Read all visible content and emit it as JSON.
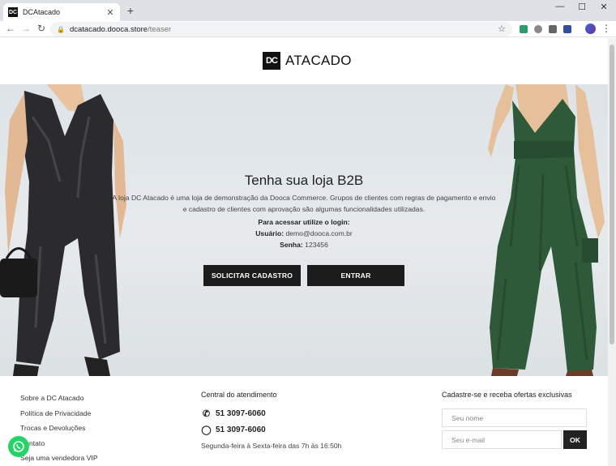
{
  "browser": {
    "tab_title": "DCAtacado",
    "tab_favicon": "DC",
    "new_tab": "+",
    "url_host": "dcatacado.dooca.store",
    "url_path": "/teaser",
    "minimize": "—",
    "maximize": "☐",
    "close": "✕"
  },
  "brand": {
    "mark": "DC",
    "name": "ATACADO"
  },
  "hero": {
    "title": "Tenha sua loja B2B",
    "description": "A loja DC Atacado é uma loja de demonstração da Dooca Commerce. Grupos de clientes com regras de pagamento e envio e cadastro de clientes com aprovação são algumas funcionalidades utilizadas.",
    "login_heading": "Para acessar utilize o login:",
    "user_label": "Usuário:",
    "user_value": "demo@dooca.com.br",
    "password_label": "Senha:",
    "password_value": "123456",
    "signup_button": "SOLICITAR CADASTRO",
    "enter_button": "ENTRAR"
  },
  "footer": {
    "links": [
      "Sobre a DC Atacado",
      "Política de Privacidade",
      "Trocas e Devoluções",
      "Contato",
      "Seja uma vendedora VIP"
    ],
    "support_heading": "Central do atendimento",
    "phone": "51 3097-6060",
    "whatsapp": "51 3097-6060",
    "hours": "Segunda-feira à Sexta-feira das 7h às 16:50h",
    "newsletter_heading": "Cadastre-se e receba ofertas exclusivas",
    "name_placeholder": "Seu nome",
    "email_placeholder": "Seu e-mail",
    "ok_button": "OK"
  },
  "colors": {
    "brand_dark": "#1c1c1c",
    "whatsapp_green": "#25d366",
    "hero_bg": "#e1e6e9"
  }
}
